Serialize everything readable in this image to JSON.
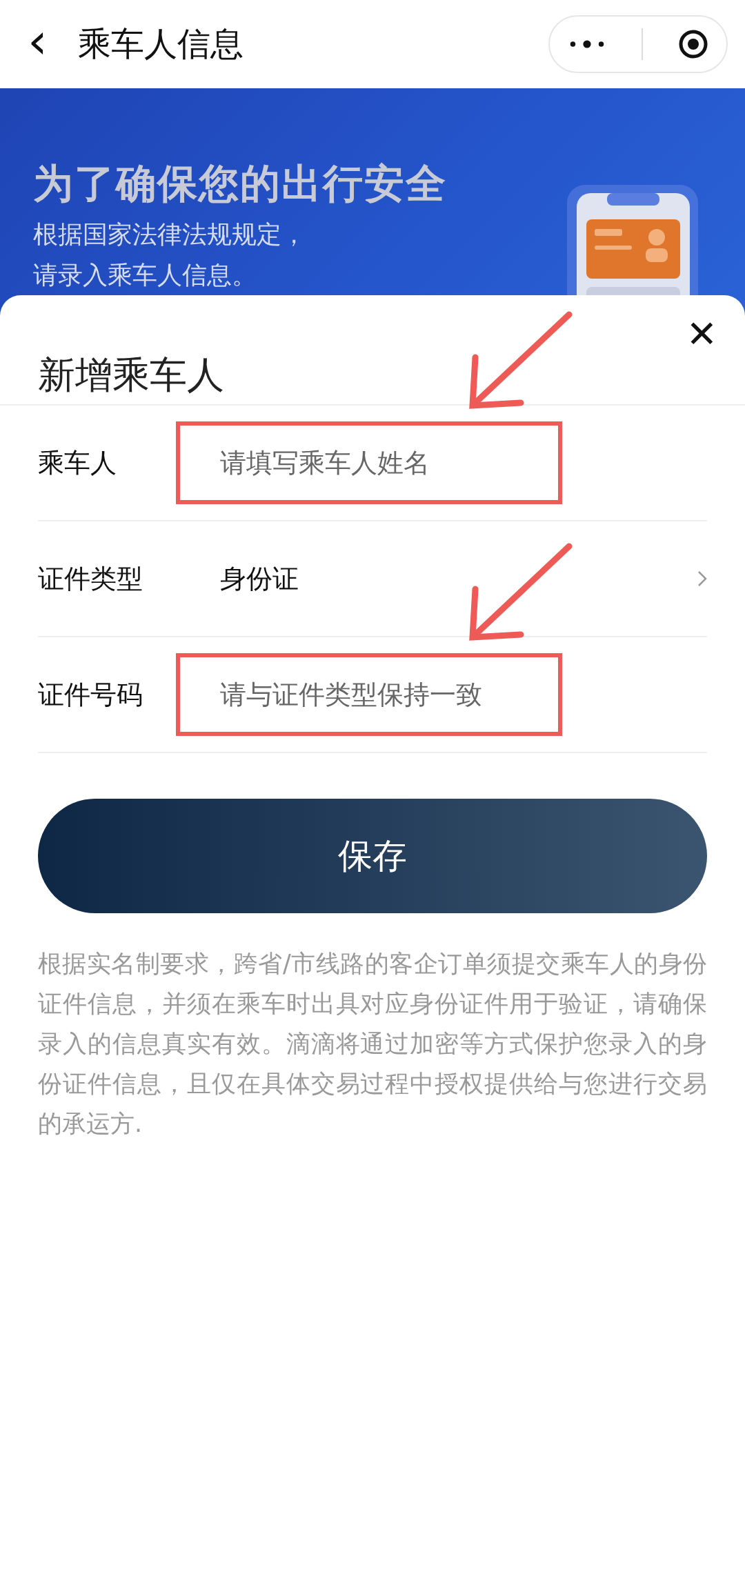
{
  "nav": {
    "back": "‹",
    "title": "乘车人信息"
  },
  "banner": {
    "headline": "为了确保您的出行安全",
    "lines": [
      "根据国家法律法规规定，",
      "请录入乘车人信息。"
    ]
  },
  "sheet": {
    "title": "新增乘车人",
    "close": "✕"
  },
  "fields": [
    {
      "kind": "input",
      "label": "乘车人",
      "placeholder": "请填写乘车人姓名",
      "highlighted": true
    },
    {
      "kind": "select",
      "label": "证件类型",
      "value": "身份证",
      "highlighted": false
    },
    {
      "kind": "input",
      "label": "证件号码",
      "placeholder": "请与证件类型保持一致",
      "highlighted": true
    }
  ],
  "save_button": "保存",
  "notice": "根据实名制要求，跨省/市线路的客企订单须提交乘车人的身份证件信息，并须在乘车时出具对应身份证件用于验证，请确保录入的信息真实有效。滴滴将通过加密等方式保护您录入的身份证件信息，且仅在具体交易过程中授权提供给与您进行交易的承运方."
}
